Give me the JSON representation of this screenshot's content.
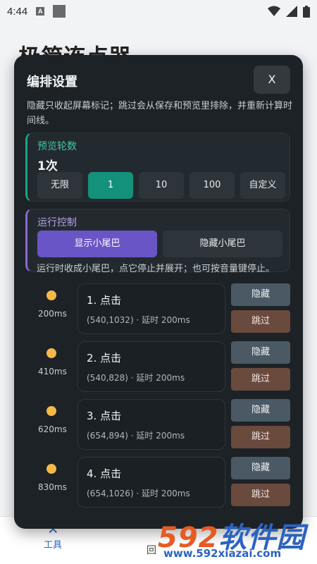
{
  "status": {
    "time": "4:44",
    "a_icon": "A"
  },
  "background": {
    "app_title": "极简连点器",
    "bottom_tabs": [
      {
        "label": "工具"
      },
      {
        "label": "回"
      }
    ]
  },
  "dialog": {
    "title": "编排设置",
    "close_label": "X",
    "description": "隐藏只收起屏幕标记；跳过会从保存和预览里排除，并重新计算时间线。",
    "preview": {
      "label": "预览轮数",
      "value": "1次",
      "options": [
        "无限",
        "1",
        "10",
        "100",
        "自定义"
      ],
      "selected": "1"
    },
    "run_control": {
      "label": "运行控制",
      "buttons": [
        "显示小尾巴",
        "隐藏小尾巴"
      ],
      "selected": "显示小尾巴",
      "hint": "运行时收成小尾巴，点它停止并展开；也可按音量键停止。"
    },
    "steps": [
      {
        "delay": "200ms",
        "title": "1. 点击",
        "detail": "(540,1032) · 延时 200ms",
        "hide": "隐藏",
        "skip": "跳过"
      },
      {
        "delay": "410ms",
        "title": "2. 点击",
        "detail": "(540,828) · 延时 200ms",
        "hide": "隐藏",
        "skip": "跳过"
      },
      {
        "delay": "620ms",
        "title": "3. 点击",
        "detail": "(654,894) · 延时 200ms",
        "hide": "隐藏",
        "skip": "跳过"
      },
      {
        "delay": "830ms",
        "title": "4. 点击",
        "detail": "(654,1026) · 延时 200ms",
        "hide": "隐藏",
        "skip": "跳过"
      }
    ]
  },
  "watermark": {
    "brand_a": "592",
    "brand_b": "软件园",
    "url": "www.592xiazai.com"
  },
  "colors": {
    "accent_teal": "#14917b",
    "accent_purple": "#6a55c6",
    "dot": "#f5b94a",
    "hide_btn": "#4a5963",
    "skip_btn": "#6b4a3e"
  }
}
